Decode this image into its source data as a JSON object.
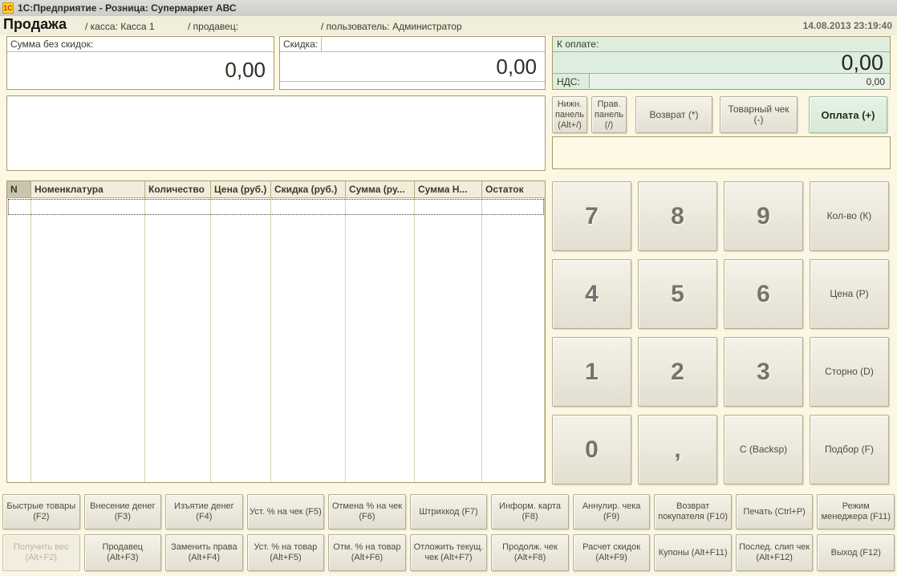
{
  "window": {
    "title": "1С:Предприятие - Розница: Супермаркет АВС",
    "icon_text": "1С"
  },
  "header": {
    "title": "Продажа",
    "register": "/ касса: Касса 1",
    "seller": "/ продавец:",
    "user": "/ пользователь: Администратор",
    "datetime": "14.08.2013 23:19:40"
  },
  "totals": {
    "sum_no_discount": {
      "label": "Сумма без скидок:",
      "value": "0,00"
    },
    "discount": {
      "label": "Скидка:",
      "value": "0,00"
    },
    "to_pay": {
      "label": "К оплате:",
      "value": "0,00"
    },
    "vat": {
      "label": "НДС:",
      "value": "0,00"
    }
  },
  "panel_buttons": {
    "bottom_panel": "Нижн. панель (Alt+/)",
    "right_panel": "Прав. панель (/)",
    "return": "Возврат (*)",
    "sales_receipt": "Товарный чек (-)",
    "payment": "Оплата (+)"
  },
  "table": {
    "columns": [
      "N",
      "Номенклатура",
      "Количество",
      "Цена (руб.)",
      "Скидка (руб.)",
      "Сумма (ру...",
      "Сумма Н...",
      "Остаток"
    ]
  },
  "numpad": {
    "keys": [
      {
        "label": "7"
      },
      {
        "label": "8"
      },
      {
        "label": "9"
      },
      {
        "label": "Кол-во (К)"
      },
      {
        "label": "4"
      },
      {
        "label": "5"
      },
      {
        "label": "6"
      },
      {
        "label": "Цена (Р)"
      },
      {
        "label": "1"
      },
      {
        "label": "2"
      },
      {
        "label": "3"
      },
      {
        "label": "Сторно (D)"
      },
      {
        "label": "0"
      },
      {
        "label": ","
      },
      {
        "label": "С (Backsp)"
      },
      {
        "label": "Подбор (F)"
      }
    ]
  },
  "bottom": {
    "row1": [
      "Быстрые товары (F2)",
      "Внесение денег (F3)",
      "Изъятие денег (F4)",
      "Уст. % на чек (F5)",
      "Отмена % на чек (F6)",
      "Штрихкод (F7)",
      "Информ. карта (F8)",
      "Аннулир. чека (F9)",
      "Возврат покупателя (F10)",
      "Печать (Ctrl+P)",
      "Режим менеджера (F11)"
    ],
    "row2": [
      "Получить вес (Alt+F2)",
      "Продавец (Alt+F3)",
      "Заменить права (Alt+F4)",
      "Уст. % на товар (Alt+F5)",
      "Отм. % на товар (Alt+F6)",
      "Отложить текущ. чек (Alt+F7)",
      "Продолж. чек (Alt+F8)",
      "Расчет скидок (Alt+F9)",
      "Купоны (Alt+F11)",
      "Послед. слип чек (Alt+F12)",
      "Выход (F12)"
    ]
  },
  "colors": {
    "background": "#FBF7E2",
    "accent_green": "#DEEEDE",
    "border_tan": "#A59C6D",
    "titlebar_gray": "#D2D2CE",
    "icon_yellow": "#FFD61C",
    "icon_red": "#D42B1E"
  }
}
